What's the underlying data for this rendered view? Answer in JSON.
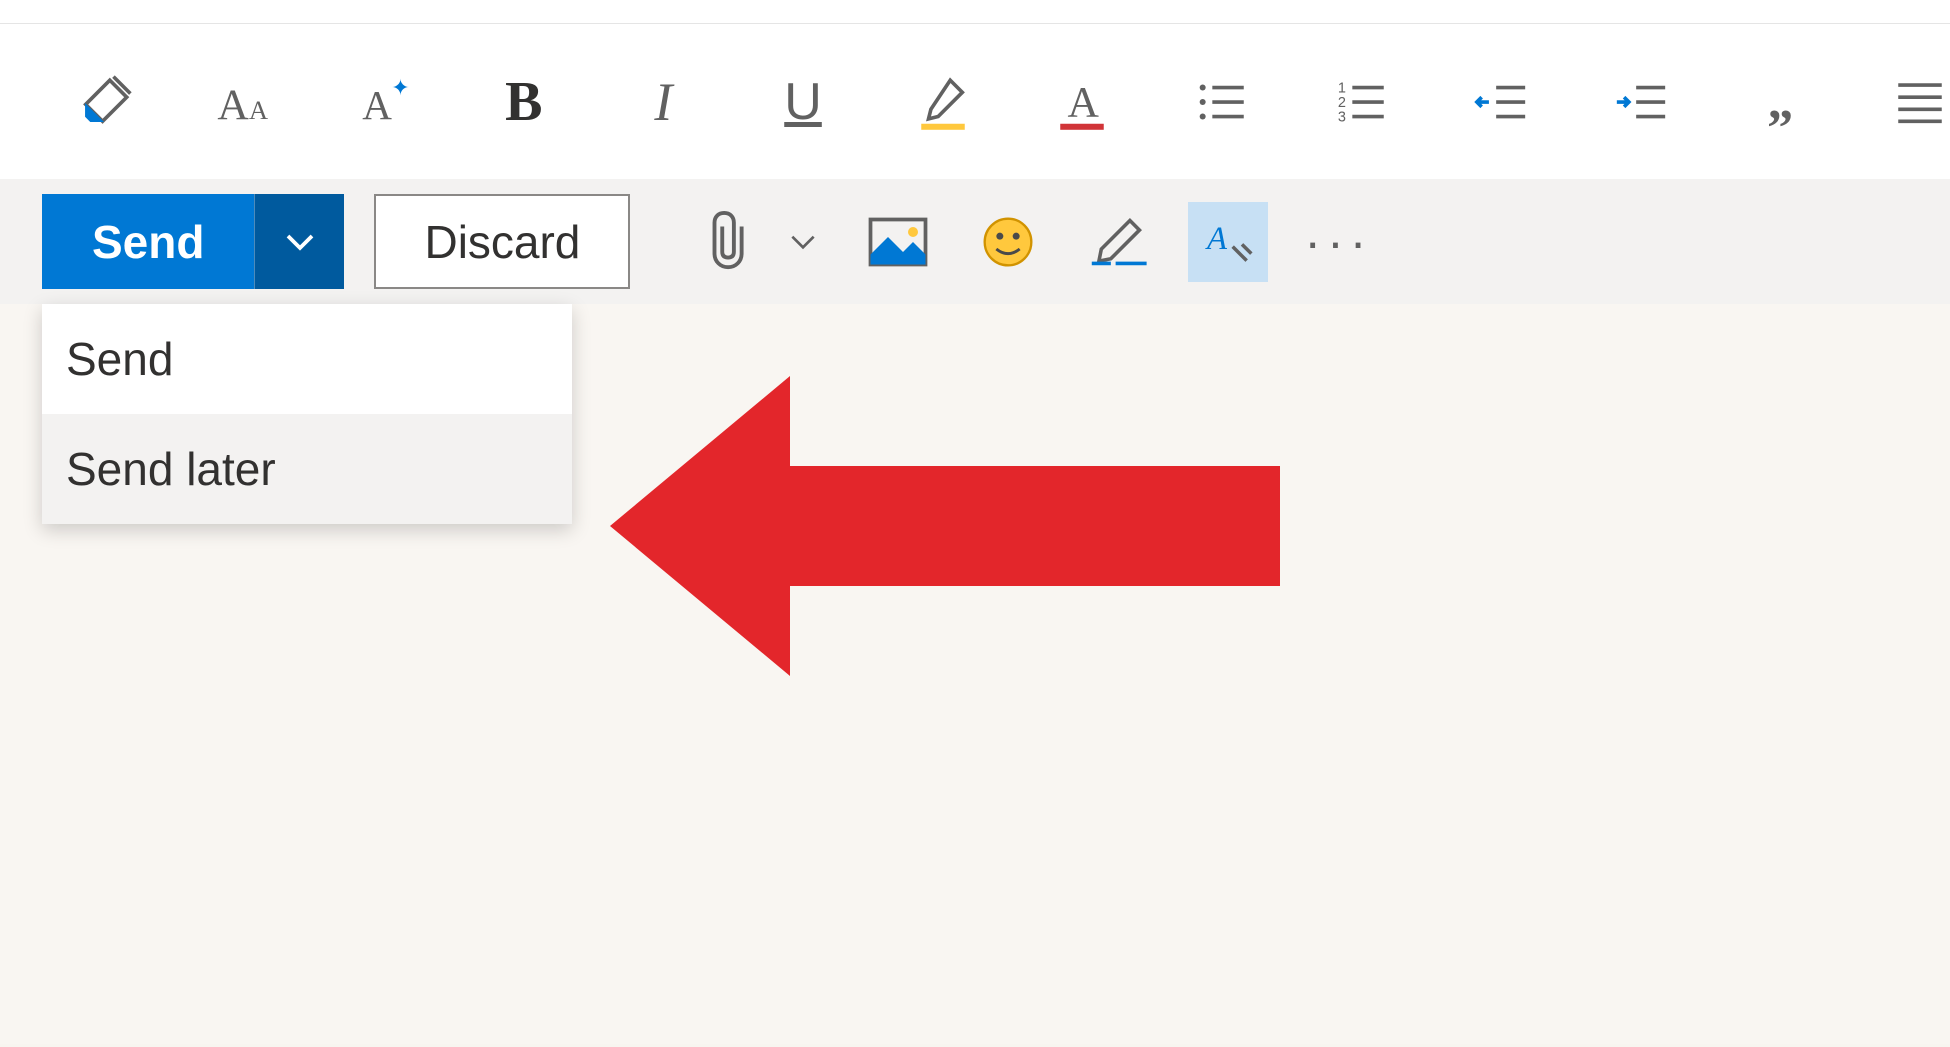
{
  "formatting": {
    "icons": {
      "format_painter": "format-painter-icon",
      "font_size": "font-size-icon",
      "clear_format": "clear-formatting-icon",
      "bold": "B",
      "italic": "I",
      "underline": "U",
      "highlight": "highlight-icon",
      "font_color": "A",
      "bullets": "bullets-icon",
      "numbering": "numbering-icon",
      "decrease_indent": "decrease-indent-icon",
      "increase_indent": "increase-indent-icon",
      "quote": "quote-icon",
      "alignment": "alignment-icon"
    }
  },
  "actions": {
    "send_label": "Send",
    "discard_label": "Discard",
    "more_label": "..."
  },
  "send_menu": {
    "items": [
      {
        "label": "Send"
      },
      {
        "label": "Send later"
      }
    ]
  },
  "colors": {
    "primary": "#0078d4",
    "primary_dark": "#005a9e",
    "arrow": "#e81123"
  }
}
